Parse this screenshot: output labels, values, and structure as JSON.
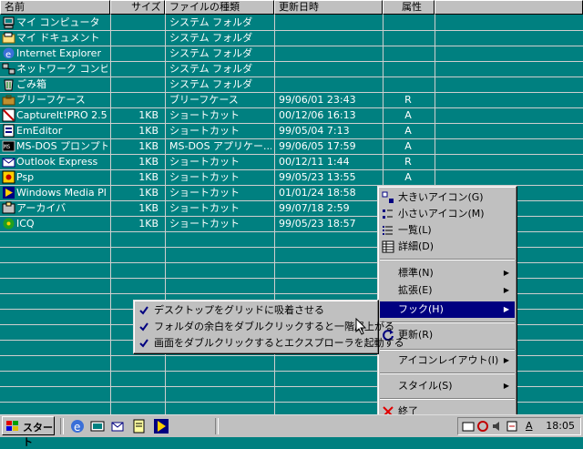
{
  "header": {
    "columns": [
      "名前",
      "サイズ",
      "ファイルの種類",
      "更新日時",
      "属性"
    ]
  },
  "rows": [
    {
      "icon": "my-computer-icon",
      "name": "マイ コンピュータ",
      "size": "",
      "type": "システム フォルダ",
      "date": "",
      "attr": ""
    },
    {
      "icon": "my-documents-icon",
      "name": "マイ ドキュメント",
      "size": "",
      "type": "システム フォルダ",
      "date": "",
      "attr": ""
    },
    {
      "icon": "internet-explorer-icon",
      "name": "Internet Explorer",
      "size": "",
      "type": "システム フォルダ",
      "date": "",
      "attr": ""
    },
    {
      "icon": "network-neighborhood-icon",
      "name": "ネットワーク コンピュータ",
      "size": "",
      "type": "システム フォルダ",
      "date": "",
      "attr": ""
    },
    {
      "icon": "recycle-bin-icon",
      "name": "ごみ箱",
      "size": "",
      "type": "システム フォルダ",
      "date": "",
      "attr": ""
    },
    {
      "icon": "briefcase-icon",
      "name": "ブリーフケース",
      "size": "",
      "type": "ブリーフケース",
      "date": "99/06/01 23:43",
      "attr": "R"
    },
    {
      "icon": "captureit-icon",
      "name": "CaptureIt!PRO 2.5",
      "size": "1KB",
      "type": "ショートカット",
      "date": "00/12/06 16:13",
      "attr": "A"
    },
    {
      "icon": "emeditor-icon",
      "name": "EmEditor",
      "size": "1KB",
      "type": "ショートカット",
      "date": "99/05/04 7:13",
      "attr": "A"
    },
    {
      "icon": "msdos-prompt-icon",
      "name": "MS-DOS プロンプト",
      "size": "1KB",
      "type": "MS-DOS アプリケー...",
      "date": "99/06/05 17:59",
      "attr": "A"
    },
    {
      "icon": "outlook-express-icon",
      "name": "Outlook Express",
      "size": "1KB",
      "type": "ショートカット",
      "date": "00/12/11 1:44",
      "attr": "R"
    },
    {
      "icon": "psp-icon",
      "name": "Psp",
      "size": "1KB",
      "type": "ショートカット",
      "date": "99/05/23 13:55",
      "attr": "A"
    },
    {
      "icon": "windows-media-player-icon",
      "name": "Windows Media Pl...",
      "size": "1KB",
      "type": "ショートカット",
      "date": "01/01/24 18:58",
      "attr": ""
    },
    {
      "icon": "archivers-icon",
      "name": "アーカイバ",
      "size": "1KB",
      "type": "ショートカット",
      "date": "99/07/18 2:59",
      "attr": ""
    },
    {
      "icon": "icq-icon",
      "name": "ICQ",
      "size": "1KB",
      "type": "ショートカット",
      "date": "99/05/23 18:57",
      "attr": ""
    }
  ],
  "context_menu": {
    "items": [
      {
        "label": "大きいアイコン(G)",
        "icon": "large-icons-icon"
      },
      {
        "label": "小さいアイコン(M)",
        "icon": "small-icons-icon"
      },
      {
        "label": "一覧(L)",
        "icon": "list-view-icon"
      },
      {
        "label": "詳細(D)",
        "icon": "details-view-icon"
      },
      {
        "label": "標準(N)",
        "submenu": true
      },
      {
        "label": "拡張(E)",
        "submenu": true
      },
      {
        "label": "フック(H)",
        "submenu": true
      },
      {
        "label": "更新(R)",
        "icon": "refresh-icon"
      },
      {
        "label": "アイコンレイアウト(I)",
        "submenu": true
      },
      {
        "label": "スタイル(S)",
        "submenu": true
      },
      {
        "label": "終了",
        "icon": "exit-icon"
      }
    ]
  },
  "submenu": {
    "items": [
      {
        "label": "デスクトップをグリッドに吸着させる",
        "checked": true
      },
      {
        "label": "フォルダの余白をダブルクリックすると一階層上がる",
        "checked": true
      },
      {
        "label": "画面をダブルクリックするとエクスプローラを起動する",
        "checked": true
      }
    ]
  },
  "taskbar": {
    "start_label": "スタート",
    "clock": "18:05",
    "ime_label": "A"
  },
  "colors": {
    "desktop": "#008080",
    "menu": "#c0c0c0",
    "highlight": "#000080"
  }
}
